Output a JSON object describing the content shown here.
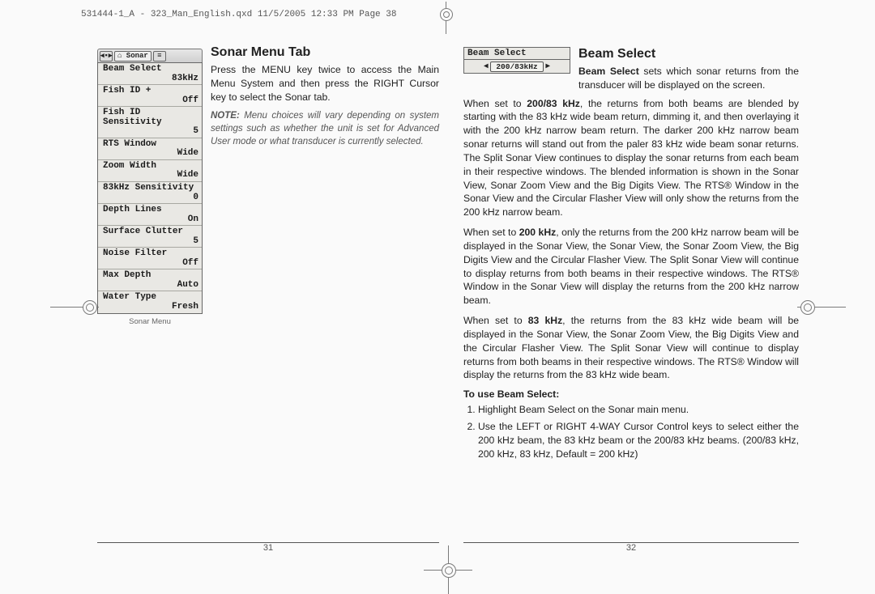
{
  "slug": "531444-1_A - 323_Man_English.qxd  11/5/2005  12:33 PM  Page 38",
  "left": {
    "heading": "Sonar Menu Tab",
    "lead": "Press the MENU key twice to access the Main Menu System and then press the RIGHT Cursor key to select the Sonar tab.",
    "note_label": "NOTE:",
    "note": "Menu choices will vary depending on system settings such as whether the unit is set for Advanced User mode or what transducer is currently selected.",
    "tabs": {
      "icon1": "◂▪▸",
      "sonar": "⌂ Sonar",
      "icon2": "≡"
    },
    "menu": [
      {
        "label": "Beam Select",
        "value": "83kHz"
      },
      {
        "label": "Fish ID +",
        "value": "Off"
      },
      {
        "label": "Fish ID Sensitivity",
        "value": "5"
      },
      {
        "label": "RTS Window",
        "value": "Wide"
      },
      {
        "label": "Zoom Width",
        "value": "Wide"
      },
      {
        "label": "83kHz Sensitivity",
        "value": "0"
      },
      {
        "label": "Depth Lines",
        "value": "On"
      },
      {
        "label": "Surface Clutter",
        "value": "5"
      },
      {
        "label": "Noise Filter",
        "value": "Off"
      },
      {
        "label": "Max Depth",
        "value": "Auto"
      },
      {
        "label": "Water Type",
        "value": "Fresh"
      }
    ],
    "lcd_caption": "Sonar Menu",
    "page_number": "31"
  },
  "right": {
    "heading": "Beam Select",
    "bs_label": "Beam Select",
    "bs_value": "200/83kHz",
    "arr_l": "◂",
    "arr_r": "▸",
    "p1_bold": "Beam Select",
    "p1": " sets which sonar returns from the transducer will be displayed on the screen.",
    "p2a": "When set to ",
    "p2b": "200/83 kHz",
    "p2c": ", the returns from both beams are blended by starting with the 83 kHz wide beam return, dimming it, and then overlaying it with the 200 kHz narrow beam return.  The darker 200 kHz narrow beam sonar returns will stand out from the paler 83 kHz wide beam sonar returns. The Split Sonar View continues to display the sonar returns from each beam in their respective windows.  The blended information is shown in the Sonar View, Sonar Zoom View and the Big Digits View.  The RTS® Window in the Sonar View and the Circular Flasher View will only show the returns from the 200 kHz narrow beam.",
    "p3a": "When set to ",
    "p3b": "200 kHz",
    "p3c": ", only the returns from the 200 kHz narrow beam will be displayed in the Sonar View, the Sonar View, the Sonar Zoom View, the Big Digits View and the Circular Flasher View.  The Split Sonar View will continue to display returns from both beams in their respective windows.  The RTS® Window in the Sonar View will display the returns from the 200 kHz narrow beam.",
    "p4a": "When set to ",
    "p4b": "83 kHz",
    "p4c": ", the returns from the 83 kHz wide beam will be displayed in the Sonar View, the Sonar Zoom View, the Big Digits View and the Circular Flasher View.  The Split Sonar View will continue to display returns from both beams in their respective windows.  The RTS® Window will display the returns from the 83 kHz wide beam.",
    "to_use": "To use Beam Select:",
    "steps": [
      "Highlight Beam Select on the Sonar main menu.",
      "Use the LEFT or RIGHT 4-WAY Cursor Control keys to select either the 200 kHz beam, the 83 kHz beam or the 200/83 kHz beams. (200/83 kHz, 200 kHz, 83 kHz, Default = 200 kHz)"
    ],
    "page_number": "32"
  }
}
